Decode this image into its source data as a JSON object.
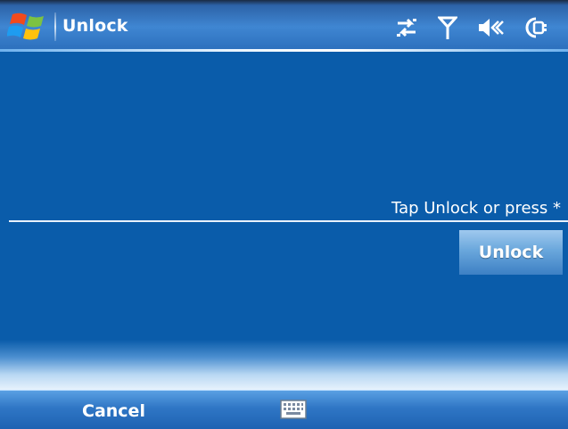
{
  "titlebar": {
    "title": "Unlock",
    "start_icon": "windows-flag-icon",
    "status_icons": [
      "connectivity-arrows-icon",
      "signal-antenna-icon",
      "speaker-muted-icon",
      "battery-charging-icon"
    ]
  },
  "content": {
    "prompt": "Tap Unlock or press *",
    "unlock_label": "Unlock"
  },
  "softkeys": {
    "left_label": "Cancel",
    "center_icon": "keyboard-icon"
  },
  "colors": {
    "background": "#0a5caa",
    "titlebar": "#3f86d2",
    "softkey_bar": "#2f76c5",
    "text": "#ffffff"
  }
}
